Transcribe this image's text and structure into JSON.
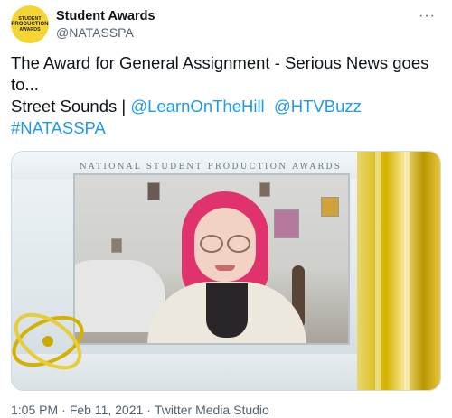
{
  "account": {
    "display_name": "Student Awards",
    "handle": "@NATASSPA",
    "avatar_lines": [
      "STUDENT",
      "PRODUCTION",
      "AWARDS"
    ]
  },
  "more_icon": "more-horizontal-icon",
  "more_glyph": "···",
  "tweet": {
    "line1": "The Award for General Assignment - Serious News goes to...",
    "line2_prefix": "Street Sounds | ",
    "mention1": "@LearnOnTheHill",
    "mention2": "@HTVBuzz",
    "hashtag": "#NATASSPA"
  },
  "media": {
    "banner_text": "NATIONAL STUDENT PRODUCTION AWARDS"
  },
  "meta": {
    "time": "1:05 PM",
    "date": "Feb 11, 2021",
    "separator": "·",
    "source": "Twitter Media Studio"
  },
  "colors": {
    "link": "#1d9bf0",
    "secondary_text": "#536471",
    "avatar_bg": "#f5d533",
    "gold": "#d3b200",
    "hair": "#e0336d"
  }
}
